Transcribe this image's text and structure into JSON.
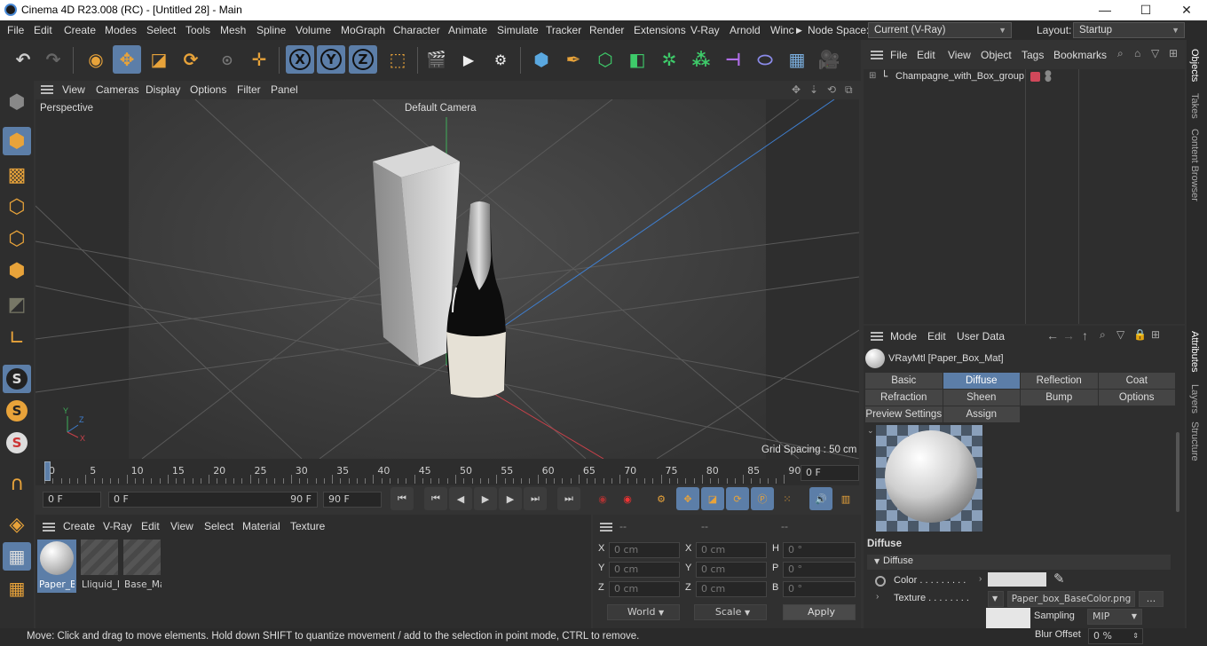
{
  "window": {
    "title": "Cinema 4D R23.008 (RC) - [Untitled 28] - Main",
    "min": "—",
    "max": "☐",
    "close": "✕"
  },
  "menu": [
    "File",
    "Edit",
    "Create",
    "Modes",
    "Select",
    "Tools",
    "Mesh",
    "Spline",
    "Volume",
    "MoGraph",
    "Character",
    "Animate",
    "Simulate",
    "Tracker",
    "Render",
    "Extensions",
    "V-Ray",
    "Arnold",
    "Winc"
  ],
  "node_space": {
    "label": "Node Space:",
    "value": "Current (V-Ray)"
  },
  "layout": {
    "label": "Layout:",
    "value": "Startup"
  },
  "viewport_menu": [
    "View",
    "Cameras",
    "Display",
    "Options",
    "Filter",
    "Panel"
  ],
  "viewport": {
    "label": "Perspective",
    "camera": "Default Camera",
    "grid_spacing": "Grid Spacing : 50 cm",
    "axis": {
      "y": "Y",
      "z": "Z",
      "x": "X"
    }
  },
  "timeline": {
    "ticks": [
      "0",
      "5",
      "10",
      "15",
      "20",
      "25",
      "30",
      "35",
      "40",
      "45",
      "50",
      "55",
      "60",
      "65",
      "70",
      "75",
      "80",
      "85",
      "90"
    ],
    "current": "0 F"
  },
  "controls": {
    "start": "0 F",
    "range_start": "0 F",
    "range_end": "90 F",
    "end": "90 F"
  },
  "mat_menu": [
    "Create",
    "V-Ray",
    "Edit",
    "View",
    "Select",
    "Material",
    "Texture"
  ],
  "materials": [
    {
      "name": "Paper_Bc",
      "selected": true
    },
    {
      "name": "Lliquid_M",
      "selected": false
    },
    {
      "name": "Base_Ma",
      "selected": false
    }
  ],
  "coords": {
    "headers": [
      "--",
      "--",
      "--"
    ],
    "rows": [
      {
        "a": "X",
        "av": "0 cm",
        "b": "X",
        "bv": "0 cm",
        "c": "H",
        "cv": "0 °"
      },
      {
        "a": "Y",
        "av": "0 cm",
        "b": "Y",
        "bv": "0 cm",
        "c": "P",
        "cv": "0 °"
      },
      {
        "a": "Z",
        "av": "0 cm",
        "b": "Z",
        "bv": "0 cm",
        "c": "B",
        "cv": "0 °"
      }
    ],
    "world": "World",
    "scale": "Scale",
    "apply": "Apply"
  },
  "obj_menu": [
    "File",
    "Edit",
    "View",
    "Object",
    "Tags",
    "Bookmarks"
  ],
  "objects": [
    {
      "name": "Champagne_with_Box_group"
    }
  ],
  "attr_menu": [
    "Mode",
    "Edit",
    "User Data"
  ],
  "material_title": "VRayMtl [Paper_Box_Mat]",
  "attr_tabs": [
    {
      "label": "Basic",
      "selected": false
    },
    {
      "label": "Diffuse",
      "selected": true
    },
    {
      "label": "Reflection",
      "selected": false
    },
    {
      "label": "Coat",
      "selected": false
    },
    {
      "label": "Refraction",
      "selected": false
    },
    {
      "label": "Sheen",
      "selected": false
    },
    {
      "label": "Bump",
      "selected": false
    },
    {
      "label": "Options",
      "selected": false
    },
    {
      "label": "Preview Settings",
      "selected": false
    },
    {
      "label": "Assign",
      "selected": false
    }
  ],
  "diffuse": {
    "section": "Diffuse",
    "group": "Diffuse",
    "color_label": "Color . . . . . . . . .",
    "texture_label": "Texture . . . . . . . .",
    "texture_file": "Paper_box_BaseColor.png",
    "more": "...",
    "sampling_label": "Sampling",
    "sampling_value": "MIP",
    "blur_label": "Blur Offset",
    "blur_value": "0 %"
  },
  "side_tabs": [
    "Objects",
    "Takes",
    "Content Browser",
    "Attributes",
    "Layers",
    "Structure"
  ],
  "status": "Move: Click and drag to move elements. Hold down SHIFT to quantize movement / add to the selection in point mode, CTRL to remove.",
  "colors": {
    "accent": "#5c7ea8",
    "orange": "#e8a33a",
    "red_tag": "#d0485a"
  }
}
